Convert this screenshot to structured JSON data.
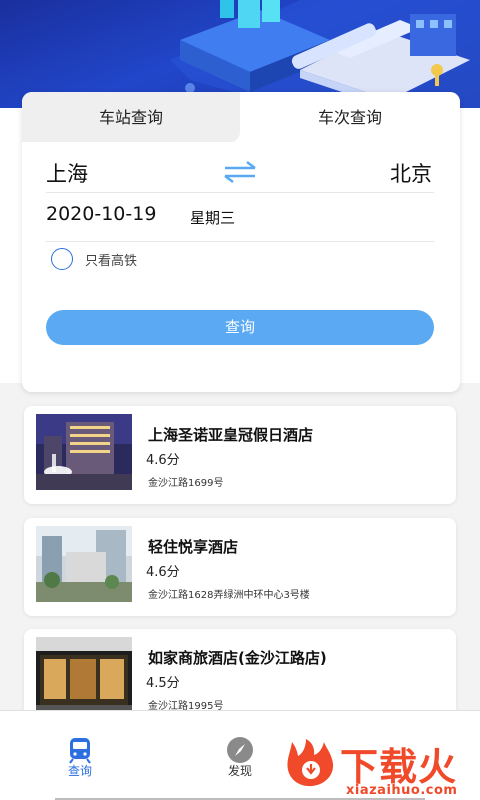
{
  "tabs": {
    "station": "车站查询",
    "train": "车次查询"
  },
  "search": {
    "from": "上海",
    "to": "北京",
    "date": "2020-10-19",
    "weekday": "星期三",
    "high_speed_only_label": "只看高铁",
    "high_speed_only_checked": false,
    "submit_label": "查询"
  },
  "hotels": [
    {
      "name": "上海圣诺亚皇冠假日酒店",
      "score": "4.6分",
      "address": "金沙江路1699号"
    },
    {
      "name": "轻住悦享酒店",
      "score": "4.6分",
      "address": "金沙江路1628弄绿洲中环中心3号楼"
    },
    {
      "name": "如家商旅酒店(金沙江路店)",
      "score": "4.5分",
      "address": "金沙江路1995号"
    }
  ],
  "bottom_nav": {
    "items": [
      {
        "label": "查询",
        "icon": "train-icon",
        "active": true
      },
      {
        "label": "发现",
        "icon": "compass-icon",
        "active": false
      }
    ]
  },
  "watermark": {
    "title": "下载火",
    "url": "xiazaihuo.com"
  },
  "colors": {
    "accent": "#5aa9f2",
    "active_nav": "#2b6fe0",
    "banner": "#2146c9",
    "watermark": "#f04a2a"
  }
}
